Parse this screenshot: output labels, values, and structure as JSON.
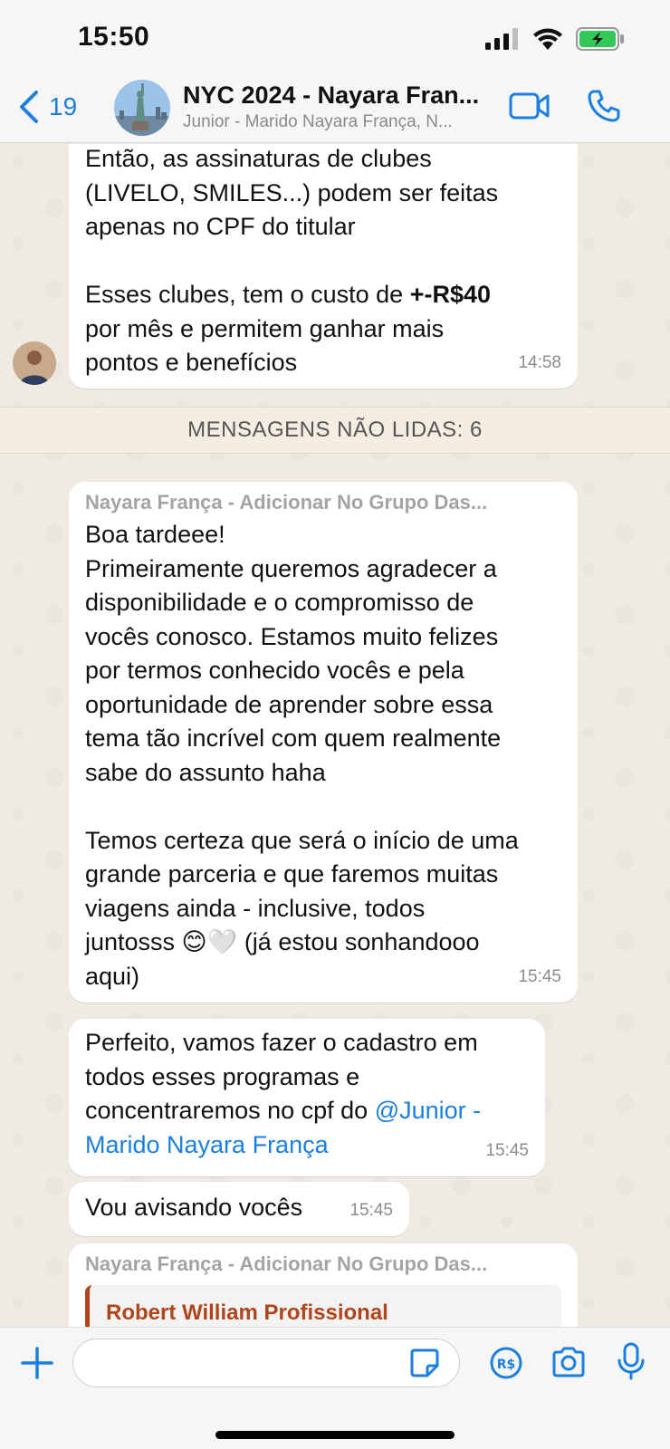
{
  "status_bar": {
    "time": "15:50"
  },
  "header": {
    "back_count": "19",
    "title": "NYC 2024 - Nayara Fran...",
    "subtitle": "Junior - Marido Nayara França, N..."
  },
  "messages": [
    {
      "text": "Então, as assinaturas de clubes\n(LIVELO, SMILES...) podem ser feitas\napenas no CPF do titular\n\nEsses clubes, tem o custo de ",
      "bold": "+-R$40",
      "text_after": "\npor mês e permitem ganhar mais\npontos e benefícios",
      "time": "14:58"
    },
    {
      "sender": "Nayara França - Adicionar No Grupo Das...",
      "text": "Boa tardeee!\nPrimeiramente queremos agradecer a\ndisponibilidade e o compromisso de\nvocês conosco. Estamos muito felizes\npor termos conhecido vocês e pela\noportunidade de aprender sobre essa\ntema tão incrível com quem realmente\nsabe do assunto haha\n\nTemos certeza que será o início de uma\ngrande parceria e que faremos muitas\nviagens ainda - inclusive, todos\njuntosss 😊🤍 (já estou sonhandooo\naqui)",
      "time": "15:45"
    },
    {
      "text": "Perfeito, vamos fazer o cadastro em\ntodos esses programas e\nconcentraremos no cpf do ",
      "mention": "@Junior -\nMarido Nayara França",
      "time": "15:45"
    },
    {
      "text": "Vou avisando vocês",
      "time": "15:45"
    },
    {
      "sender": "Nayara França - Adicionar No Grupo Das...",
      "quoted_name": "Robert William Profissional"
    }
  ],
  "unread_banner": "MENSAGENS NÃO LIDAS: 6",
  "input": {
    "placeholder": ""
  },
  "icons": {
    "back": "chevron-left-icon",
    "video": "video-camera-icon",
    "call": "phone-icon",
    "plus": "plus-icon",
    "sticker": "sticker-icon",
    "pix": "currency-icon",
    "camera": "camera-icon",
    "mic": "microphone-icon"
  },
  "colors": {
    "accent": "#1a7fe0",
    "quote_accent": "#b0451c",
    "chat_bg": "#efeae2",
    "battery": "#34c759"
  }
}
